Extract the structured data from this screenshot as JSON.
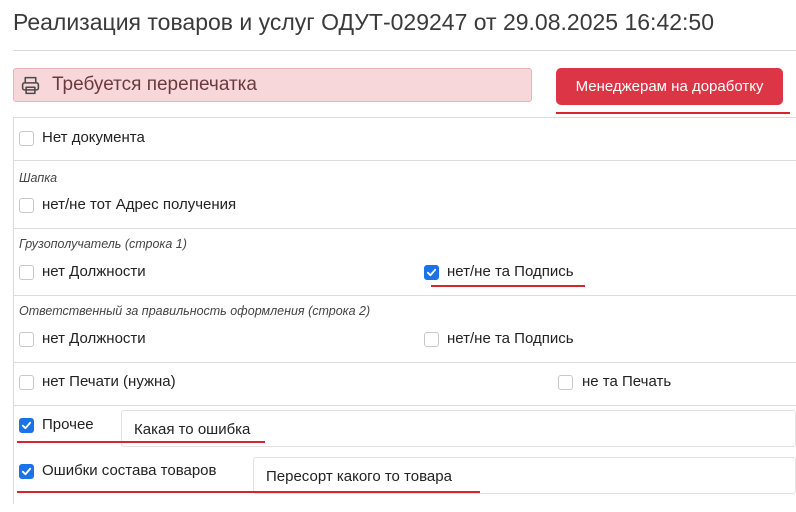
{
  "header": {
    "title": "Реализация товаров и услуг ОДУТ-029247 от 29.08.2025 16:42:50"
  },
  "alert": {
    "icon": "printer-icon",
    "text": "Требуется перепечатка"
  },
  "actions": {
    "managers_label": "Менеджерам на доработку"
  },
  "checks": {
    "no_document": {
      "label": "Нет документа",
      "checked": false
    },
    "header_section": {
      "title": "Шапка",
      "address": {
        "label": "нет/не тот Адрес получения",
        "checked": false
      }
    },
    "consignee_section": {
      "title": "Грузополучатель (строка 1)",
      "position": {
        "label": "нет Должности",
        "checked": false
      },
      "signature": {
        "label": "нет/не та Подпись",
        "checked": true
      }
    },
    "responsible_section": {
      "title": "Ответственный за правильность оформления (строка 2)",
      "position": {
        "label": "нет Должности",
        "checked": false
      },
      "signature": {
        "label": "нет/не та Подпись",
        "checked": false
      },
      "stamp_missing": {
        "label": "нет Печати (нужна)",
        "checked": false
      },
      "stamp_wrong": {
        "label": "не та Печать",
        "checked": false
      }
    },
    "other": {
      "label": "Прочее",
      "checked": true,
      "value": "Какая то ошибка"
    },
    "composition": {
      "label": "Ошибки состава товаров",
      "checked": true,
      "value": "Пересорт какого то товара"
    }
  },
  "colors": {
    "accent_red": "#dc3545",
    "checkbox_blue": "#1a73e8",
    "alert_bg": "#f8d7da",
    "annotation_red": "#d5252f"
  }
}
